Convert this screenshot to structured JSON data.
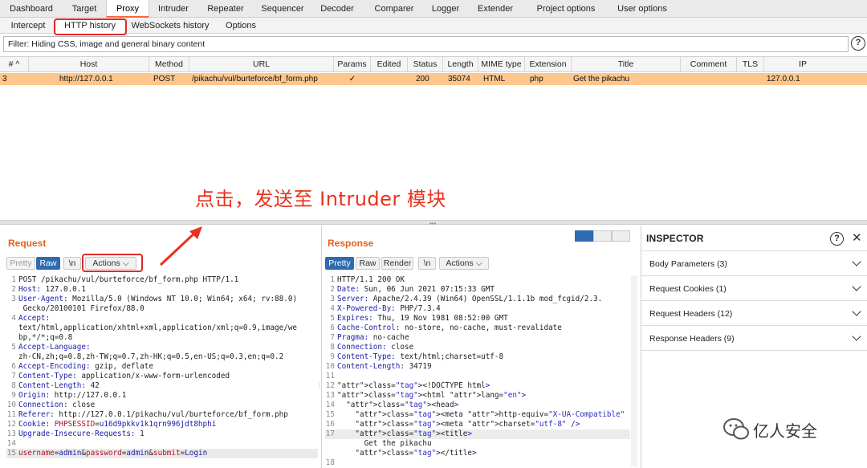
{
  "top_tabs": [
    "Dashboard",
    "Target",
    "Proxy",
    "Intruder",
    "Repeater",
    "Sequencer",
    "Decoder",
    "Comparer",
    "Logger",
    "Extender",
    "Project options",
    "User options"
  ],
  "sub_tabs": [
    "Intercept",
    "HTTP history",
    "WebSockets history",
    "Options"
  ],
  "filter": "Filter: Hiding CSS, image and general binary content",
  "help_symbol": "?",
  "table": {
    "columns": [
      "# ^",
      "Host",
      "Method",
      "URL",
      "Params",
      "Edited",
      "Status",
      "Length",
      "MIME type",
      "Extension",
      "Title",
      "Comment",
      "TLS",
      "IP"
    ],
    "rows": [
      [
        "3",
        "http://127.0.0.1",
        "POST",
        "/pikachu/vul/burteforce/bf_form.php",
        "✓",
        "",
        "200",
        "35074",
        "HTML",
        "php",
        "Get the pikachu",
        "",
        "",
        "127.0.0.1"
      ]
    ]
  },
  "annotation": "点击，发送至 Intruder 模块",
  "request": {
    "title": "Request",
    "buttons": [
      "Pretty",
      "Raw",
      "\\n",
      "Actions ⌵"
    ],
    "lines": [
      {
        "n": "1",
        "k": "",
        "v": "POST /pikachu/vul/burteforce/bf_form.php HTTP/1.1"
      },
      {
        "n": "2",
        "k": "Host:",
        "v": " 127.0.0.1"
      },
      {
        "n": "3",
        "k": "User-Agent:",
        "v": " Mozilla/5.0 (Windows NT 10.0; Win64; x64; rv:88.0)"
      },
      {
        "n": "",
        "k": "",
        "v": " Gecko/20100101 Firefox/88.0"
      },
      {
        "n": "4",
        "k": "Accept:",
        "v": ""
      },
      {
        "n": "",
        "k": "",
        "v": "text/html,application/xhtml+xml,application/xml;q=0.9,image/we"
      },
      {
        "n": "",
        "k": "",
        "v": "bp,*/*;q=0.8"
      },
      {
        "n": "5",
        "k": "Accept-Language:",
        "v": ""
      },
      {
        "n": "",
        "k": "",
        "v": "zh-CN,zh;q=0.8,zh-TW;q=0.7,zh-HK;q=0.5,en-US;q=0.3,en;q=0.2"
      },
      {
        "n": "6",
        "k": "Accept-Encoding:",
        "v": " gzip, deflate"
      },
      {
        "n": "7",
        "k": "Content-Type:",
        "v": " application/x-www-form-urlencoded"
      },
      {
        "n": "8",
        "k": "Content-Length:",
        "v": " 42"
      },
      {
        "n": "9",
        "k": "Origin:",
        "v": " http://127.0.0.1"
      },
      {
        "n": "10",
        "k": "Connection:",
        "v": " close"
      },
      {
        "n": "11",
        "k": "Referer:",
        "v": " http://127.0.0.1/pikachu/vul/burteforce/bf_form.php"
      },
      {
        "n": "12",
        "k": "Cookie:",
        "v": " PHPSESSID=u16d9pkkv1k1qrn996jdt8hphi"
      },
      {
        "n": "13",
        "k": "Upgrade-Insecure-Requests:",
        "v": " 1"
      },
      {
        "n": "14",
        "k": "",
        "v": ""
      },
      {
        "n": "15",
        "k": "",
        "v": "username=admin&password=admin&submit=Login"
      }
    ]
  },
  "response": {
    "title": "Response",
    "buttons": [
      "Pretty",
      "Raw",
      "Render",
      "\\n",
      "Actions ⌵"
    ],
    "lines": [
      {
        "n": "1",
        "k": "",
        "v": "HTTP/1.1 200 OK"
      },
      {
        "n": "2",
        "k": "Date:",
        "v": " Sun, 06 Jun 2021 07:15:33 GMT"
      },
      {
        "n": "3",
        "k": "Server:",
        "v": " Apache/2.4.39 (Win64) OpenSSL/1.1.1b mod_fcgid/2.3."
      },
      {
        "n": "4",
        "k": "X-Powered-By:",
        "v": " PHP/7.3.4"
      },
      {
        "n": "5",
        "k": "Expires:",
        "v": " Thu, 19 Nov 1981 08:52:00 GMT"
      },
      {
        "n": "6",
        "k": "Cache-Control:",
        "v": " no-store, no-cache, must-revalidate"
      },
      {
        "n": "7",
        "k": "Pragma:",
        "v": " no-cache"
      },
      {
        "n": "8",
        "k": "Connection:",
        "v": " close"
      },
      {
        "n": "9",
        "k": "Content-Type:",
        "v": " text/html;charset=utf-8"
      },
      {
        "n": "10",
        "k": "Content-Length:",
        "v": " 34719"
      },
      {
        "n": "11",
        "k": "",
        "v": ""
      },
      {
        "n": "12",
        "k": "",
        "v": "<!DOCTYPE html>"
      },
      {
        "n": "13",
        "k": "",
        "v": "<html lang=\"en\">"
      },
      {
        "n": "14",
        "k": "",
        "v": "  <head>"
      },
      {
        "n": "15",
        "k": "",
        "v": "    <meta http-equiv=\"X-UA-Compatible\" content=\"IE=edge,chr"
      },
      {
        "n": "16",
        "k": "",
        "v": "    <meta charset=\"utf-8\" />"
      },
      {
        "n": "17",
        "k": "",
        "v": "    <title>"
      },
      {
        "n": "",
        "k": "",
        "v": "      Get the pikachu"
      },
      {
        "n": "",
        "k": "",
        "v": "    </title>"
      },
      {
        "n": "18",
        "k": "",
        "v": ""
      }
    ]
  },
  "inspector": {
    "title": "INSPECTOR",
    "sections": [
      "Body Parameters (3)",
      "Request Cookies (1)",
      "Request Headers (12)",
      "Response Headers (9)"
    ]
  },
  "watermark": "亿人安全",
  "colors": {
    "accent": "#e8601c",
    "selected_row": "#ffc68c",
    "annotation": "#e8321e",
    "button_selected": "#2e6bb0"
  }
}
